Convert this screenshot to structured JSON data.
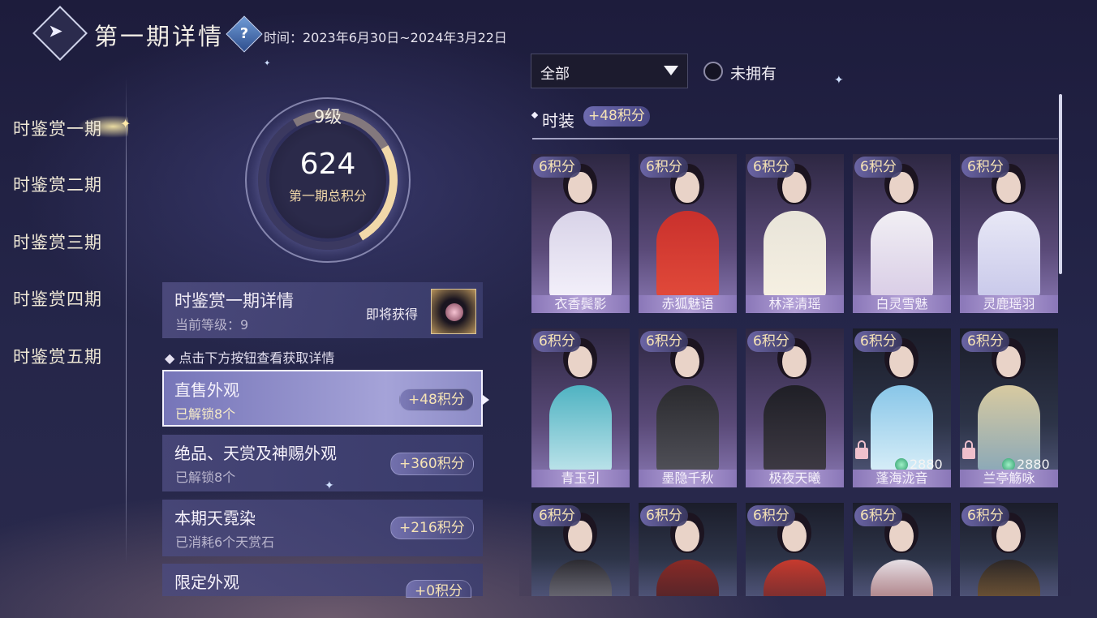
{
  "header": {
    "title": "第一期详情",
    "help_icon": "?",
    "time_text": "时间：2023年6月30日~2024年3月22日"
  },
  "nav": {
    "items": [
      {
        "label": "时鉴赏一期",
        "active": true
      },
      {
        "label": "时鉴赏二期",
        "active": false
      },
      {
        "label": "时鉴赏三期",
        "active": false
      },
      {
        "label": "时鉴赏四期",
        "active": false
      },
      {
        "label": "时鉴赏五期",
        "active": false
      }
    ]
  },
  "score": {
    "level": "9级",
    "value": "624",
    "label": "第一期总积分"
  },
  "detail": {
    "title": "时鉴赏一期详情",
    "current_level": "当前等级：9",
    "upcoming_label": "即将获得"
  },
  "hint": "点击下方按钮查看获取详情",
  "categories": [
    {
      "title": "直售外观",
      "sub": "已解锁8个",
      "badge": "+48积分",
      "active": true
    },
    {
      "title": "绝品、天赏及神赐外观",
      "sub": "已解锁8个",
      "badge": "+360积分",
      "active": false
    },
    {
      "title": "本期天霓染",
      "sub": "已消耗6个天赏石",
      "badge": "+216积分",
      "active": false
    },
    {
      "title": "限定外观",
      "sub": "",
      "badge": "+0积分",
      "active": false
    }
  ],
  "filter": {
    "selected": "全部",
    "unowned_label": "未拥有"
  },
  "section": {
    "title": "时装",
    "badge": "+48积分"
  },
  "costumes": [
    {
      "points": "6积分",
      "name": "衣香鬓影",
      "locked": false,
      "price": ""
    },
    {
      "points": "6积分",
      "name": "赤狐魅语",
      "locked": false,
      "price": ""
    },
    {
      "points": "6积分",
      "name": "林泽清瑶",
      "locked": false,
      "price": ""
    },
    {
      "points": "6积分",
      "name": "白灵雪魅",
      "locked": false,
      "price": ""
    },
    {
      "points": "6积分",
      "name": "灵鹿瑶羽",
      "locked": false,
      "price": ""
    },
    {
      "points": "6积分",
      "name": "青玉引",
      "locked": false,
      "price": ""
    },
    {
      "points": "6积分",
      "name": "墨隐千秋",
      "locked": false,
      "price": ""
    },
    {
      "points": "6积分",
      "name": "极夜天曦",
      "locked": false,
      "price": ""
    },
    {
      "points": "6积分",
      "name": "蓬海泷音",
      "locked": true,
      "price": "2880"
    },
    {
      "points": "6积分",
      "name": "兰亭觞咏",
      "locked": true,
      "price": "2880"
    },
    {
      "points": "6积分",
      "name": "",
      "locked": false,
      "price": ""
    },
    {
      "points": "6积分",
      "name": "",
      "locked": false,
      "price": ""
    },
    {
      "points": "6积分",
      "name": "",
      "locked": false,
      "price": ""
    },
    {
      "points": "6积分",
      "name": "",
      "locked": false,
      "price": ""
    },
    {
      "points": "6积分",
      "name": "",
      "locked": false,
      "price": ""
    }
  ],
  "colors": {
    "accent_gold": "#f6e3b5",
    "card_purple": "#8a77b8",
    "bg_dark": "#1d1c3c"
  },
  "icons": {
    "back": "back-arrow-icon",
    "help": "question-icon",
    "dropdown": "triangle-down-icon",
    "lock": "lock-icon",
    "jade": "jade-currency-icon"
  }
}
